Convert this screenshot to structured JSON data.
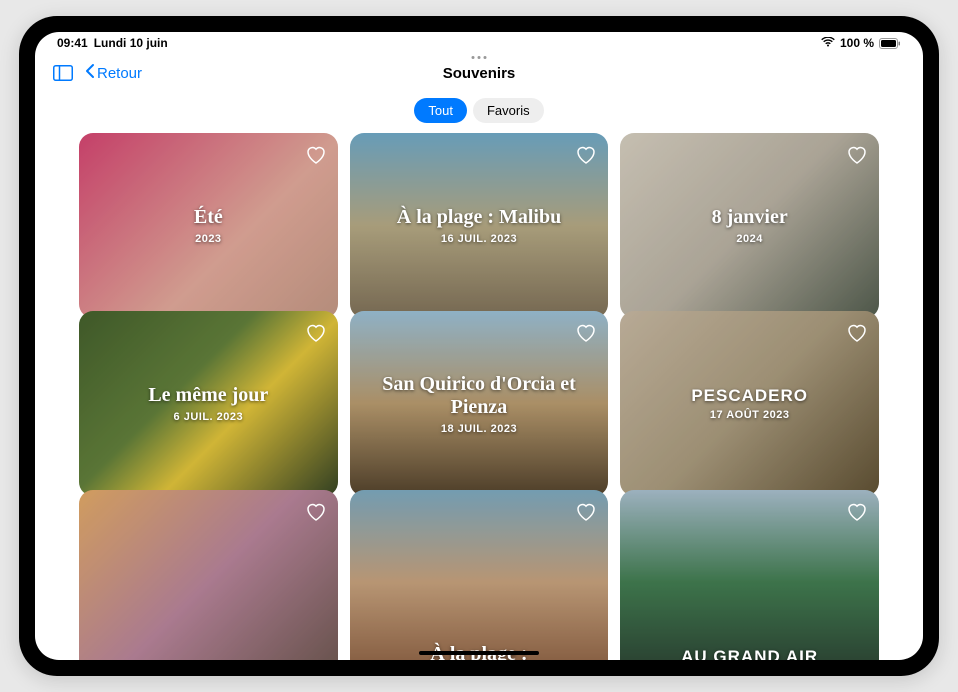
{
  "status": {
    "time": "09:41",
    "date": "Lundi 10 juin",
    "battery": "100 %"
  },
  "nav": {
    "back_label": "Retour",
    "title": "Souvenirs"
  },
  "segments": {
    "all": "Tout",
    "favorites": "Favoris"
  },
  "memories": [
    {
      "title": "Été",
      "date": "2023",
      "style": "serif"
    },
    {
      "title": "À la plage : Malibu",
      "date": "16 JUIL. 2023",
      "style": "serif"
    },
    {
      "title": "8 janvier",
      "date": "2024",
      "style": "serif"
    },
    {
      "title": "Le même jour",
      "date": "6 JUIL. 2023",
      "style": "serif"
    },
    {
      "title": "San Quirico d'Orcia et Pienza",
      "date": "18 JUIL. 2023",
      "style": "serif"
    },
    {
      "title": "PESCADERO",
      "date": "17 AOÛT 2023",
      "style": "caps"
    },
    {
      "title": "",
      "date": "",
      "style": "serif"
    },
    {
      "title": "À la plage :",
      "date": "",
      "style": "serif"
    },
    {
      "title": "AU GRAND AIR",
      "date": "",
      "style": "caps"
    }
  ]
}
